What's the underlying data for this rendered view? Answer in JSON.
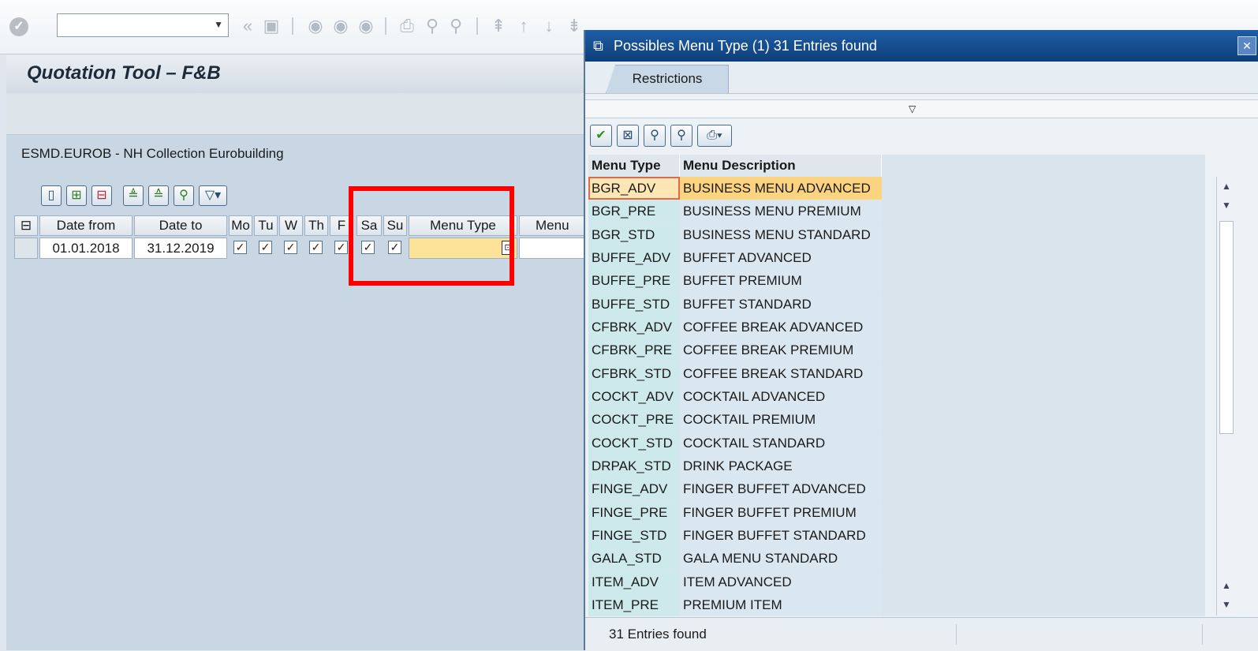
{
  "screen": {
    "title": "Quotation Tool – F&B",
    "hotel": "ESMD.EUROB - NH Collection Eurobuilding"
  },
  "grid": {
    "columns": [
      "Date from",
      "Date to",
      "Mo",
      "Tu",
      "W",
      "Th",
      "F",
      "Sa",
      "Su",
      "Menu Type",
      "Menu"
    ],
    "row": {
      "date_from": "01.01.2018",
      "date_to": "31.12.2019",
      "checks": [
        "✓",
        "✓",
        "✓",
        "✓",
        "✓",
        "✓",
        "✓"
      ],
      "menu_type": ""
    }
  },
  "popup": {
    "title": "Possibles Menu Type (1)   31 Entries found",
    "tab": "Restrictions",
    "headers": {
      "code": "Menu Type",
      "desc": "Menu Description"
    },
    "rows": [
      {
        "code": "BGR_ADV",
        "desc": "BUSINESS MENU ADVANCED"
      },
      {
        "code": "BGR_PRE",
        "desc": "BUSINESS MENU PREMIUM"
      },
      {
        "code": "BGR_STD",
        "desc": "BUSINESS MENU STANDARD"
      },
      {
        "code": "BUFFE_ADV",
        "desc": "BUFFET ADVANCED"
      },
      {
        "code": "BUFFE_PRE",
        "desc": "BUFFET PREMIUM"
      },
      {
        "code": "BUFFE_STD",
        "desc": "BUFFET STANDARD"
      },
      {
        "code": "CFBRK_ADV",
        "desc": "COFFEE BREAK ADVANCED"
      },
      {
        "code": "CFBRK_PRE",
        "desc": "COFFEE BREAK PREMIUM"
      },
      {
        "code": "CFBRK_STD",
        "desc": "COFFEE BREAK STANDARD"
      },
      {
        "code": "COCKT_ADV",
        "desc": "COCKTAIL ADVANCED"
      },
      {
        "code": "COCKT_PRE",
        "desc": "COCKTAIL PREMIUM"
      },
      {
        "code": "COCKT_STD",
        "desc": "COCKTAIL STANDARD"
      },
      {
        "code": "DRPAK_STD",
        "desc": "DRINK PACKAGE"
      },
      {
        "code": "FINGE_ADV",
        "desc": "FINGER BUFFET ADVANCED"
      },
      {
        "code": "FINGE_PRE",
        "desc": "FINGER BUFFET PREMIUM"
      },
      {
        "code": "FINGE_STD",
        "desc": "FINGER BUFFET STANDARD"
      },
      {
        "code": "GALA_STD",
        "desc": "GALA MENU STANDARD"
      },
      {
        "code": "ITEM_ADV",
        "desc": "ITEM ADVANCED"
      },
      {
        "code": "ITEM_PRE",
        "desc": "PREMIUM ITEM"
      }
    ],
    "status": "31 Entries found"
  },
  "colors": {
    "popup_title": "#0e3e78",
    "selection": "#fcd37f",
    "highlight_box": "#ff0000"
  }
}
